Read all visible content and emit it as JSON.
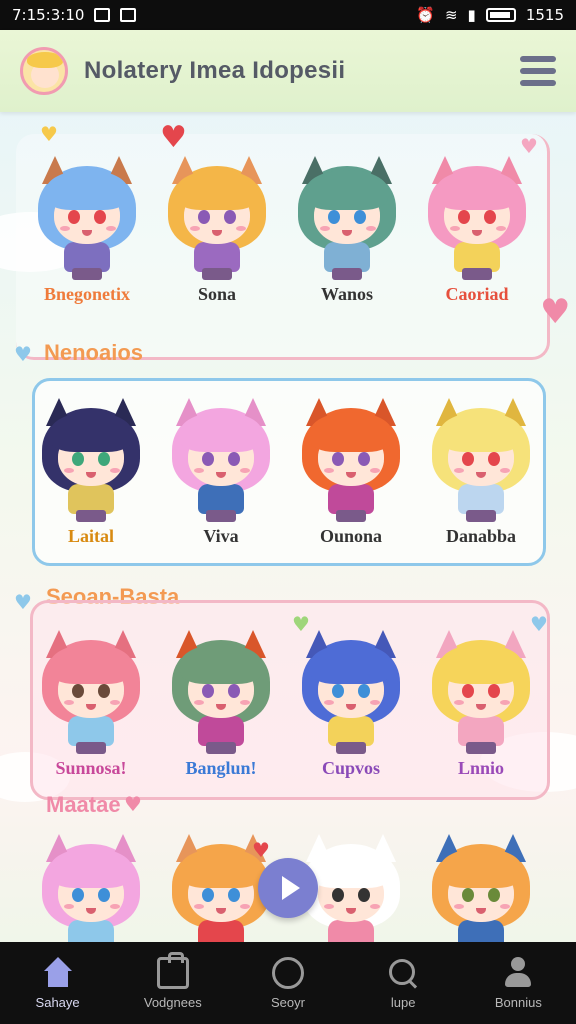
{
  "status_bar": {
    "time": "7:15:3:10",
    "right_text": "1515"
  },
  "header": {
    "title": "Nolatery Imea Idopesii",
    "logo_icon": "avatar-logo-icon",
    "menu_icon": "hamburger-menu-icon"
  },
  "sections": [
    {
      "title": "Nenoaios",
      "title_color": "#f39a52",
      "panel_border": "#f3b8c6",
      "panel_bg": "rgba(255,255,255,0.35)",
      "characters": [
        {
          "name": "Bnegonetix",
          "name_color": "#ef7b3b",
          "hair": "#7eb4ef",
          "ear": "#c97a4c",
          "eye": "#e4464c",
          "outfit": "#7d6fbf"
        },
        {
          "name": "Sona",
          "name_color": "#333333",
          "hair": "#f4b648",
          "ear": "#e7955a",
          "eye": "#8a5ab5",
          "outfit": "#9b6ac0"
        },
        {
          "name": "Wanos",
          "name_color": "#333333",
          "hair": "#5fa08e",
          "ear": "#4a6f66",
          "eye": "#3e8fd8",
          "outfit": "#7fb0d4"
        },
        {
          "name": "Caoriad",
          "name_color": "#e6503d",
          "hair": "#f59ac2",
          "ear": "#f08aa8",
          "eye": "#e4464c",
          "outfit": "#f3d25a"
        }
      ]
    },
    {
      "title": "",
      "title_color": "#333333",
      "panel_border": "#8ec8ea",
      "panel_bg": "rgba(255,255,255,0.7)",
      "characters": [
        {
          "name": "Laital",
          "name_color": "#d88a10",
          "hair": "#34326a",
          "ear": "#2a2a55",
          "eye": "#3ea77a",
          "outfit": "#e0c45c"
        },
        {
          "name": "Viva",
          "name_color": "#333333",
          "hair": "#f3a6e0",
          "ear": "#e590c8",
          "eye": "#8a5ab5",
          "outfit": "#3e6fb8"
        },
        {
          "name": "Ounona",
          "name_color": "#333333",
          "hair": "#f0682f",
          "ear": "#d9562a",
          "eye": "#8a5ab5",
          "outfit": "#c04a9a"
        },
        {
          "name": "Danabba",
          "name_color": "#333333",
          "hair": "#f6e27a",
          "ear": "#e0b63f",
          "eye": "#e4464c",
          "outfit": "#bcd6ef"
        }
      ]
    },
    {
      "title": "Seoan-Basta",
      "title_color": "#f39a52",
      "panel_border": "#f3b8c6",
      "panel_bg": "rgba(255,228,236,0.55)",
      "characters": [
        {
          "name": "Sunnosa!",
          "name_color": "#c8489a",
          "hair": "#f28498",
          "ear": "#e57080",
          "eye": "#6a4a3a",
          "outfit": "#8ec8ea"
        },
        {
          "name": "Banglun!",
          "name_color": "#3b7ad6",
          "hair": "#6f9c78",
          "ear": "#d9562a",
          "eye": "#8a5ab5",
          "outfit": "#c04a9a"
        },
        {
          "name": "Cupvos",
          "name_color": "#8a4ab8",
          "hair": "#4e6cd6",
          "ear": "#4558b8",
          "eye": "#3e8fd8",
          "outfit": "#f3d25a"
        },
        {
          "name": "Lnnio",
          "name_color": "#9a4ab8",
          "hair": "#f6d45a",
          "ear": "#f2a6c0",
          "eye": "#e4464c",
          "outfit": "#f3a6c0"
        }
      ]
    },
    {
      "title": "Maatae",
      "title_color": "#f08aa8",
      "panel_border": "transparent",
      "panel_bg": "transparent",
      "characters": [
        {
          "name": "",
          "name_color": "#333333",
          "hair": "#f3a6e0",
          "ear": "#e590c8",
          "eye": "#3e8fd8",
          "outfit": "#8ec8ea"
        },
        {
          "name": "",
          "name_color": "#333333",
          "hair": "#f5a54a",
          "ear": "#e7955a",
          "eye": "#3e8fd8",
          "outfit": "#e4464c"
        },
        {
          "name": "",
          "name_color": "#333333",
          "hair": "#ffffff",
          "ear": "#ffffff",
          "eye": "#333333",
          "outfit": "#f08aa8"
        },
        {
          "name": "",
          "name_color": "#333333",
          "hair": "#f5a54a",
          "ear": "#3e6fb8",
          "eye": "#6a8a3a",
          "outfit": "#3e6fb8"
        }
      ]
    }
  ],
  "play_button": {
    "icon": "play-icon",
    "color": "#7b7fd0"
  },
  "bottom_nav": [
    {
      "label": "Sahaye",
      "icon": "home-icon",
      "active": true
    },
    {
      "label": "Vodgnees",
      "icon": "bag-icon",
      "active": false
    },
    {
      "label": "Seoyr",
      "icon": "circle-icon",
      "active": false
    },
    {
      "label": "lupe",
      "icon": "search-icon",
      "active": false
    },
    {
      "label": "Bonnius",
      "icon": "user-icon",
      "active": false
    }
  ],
  "colors": {
    "accent": "#9aa0e8",
    "nav_bg": "#101010",
    "header_bg": "#dff1cc"
  }
}
